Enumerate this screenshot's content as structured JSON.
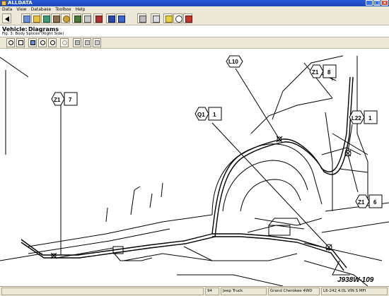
{
  "window": {
    "title": "ALLDATA"
  },
  "menu": [
    "Data",
    "View",
    "Database",
    "Toolbox",
    "Help"
  ],
  "vehicle": {
    "label": "Vehicle:",
    "section": "Diagrams",
    "figure": "Fig. 3: Body Splices (Right Side)"
  },
  "callouts": [
    {
      "code": "L10",
      "num": ""
    },
    {
      "code": "Z1",
      "num": "8"
    },
    {
      "code": "Z1",
      "num": "7"
    },
    {
      "code": "Q1",
      "num": "1"
    },
    {
      "code": "L22",
      "num": "1"
    },
    {
      "code": "Z1",
      "num": "6"
    }
  ],
  "figure_code": "J938W-109",
  "status": {
    "page": "94",
    "make": "Jeep Truck",
    "model": "Grand Cherokee 4WD",
    "engine": "L6-242 4.0L VIN S MFI"
  },
  "toolbar_icons": [
    "back-icon",
    "home-icon",
    "folder-icon",
    "tools-icon",
    "vehicle-icon",
    "gear-icon",
    "book-icon",
    "stack-icon",
    "bookmark-icon",
    "clock-icon",
    "tag-icon",
    "print-icon",
    "print-preview-icon",
    "help-icon",
    "search-icon",
    "exit-icon"
  ],
  "diagram_tools": [
    "zoom-in-icon",
    "pan-icon",
    "zoom-area-icon",
    "zoom-fit-icon",
    "zoom-out-icon",
    "zoom-disabled-icon",
    "print-diagram-icon",
    "copy-diagram-icon"
  ]
}
